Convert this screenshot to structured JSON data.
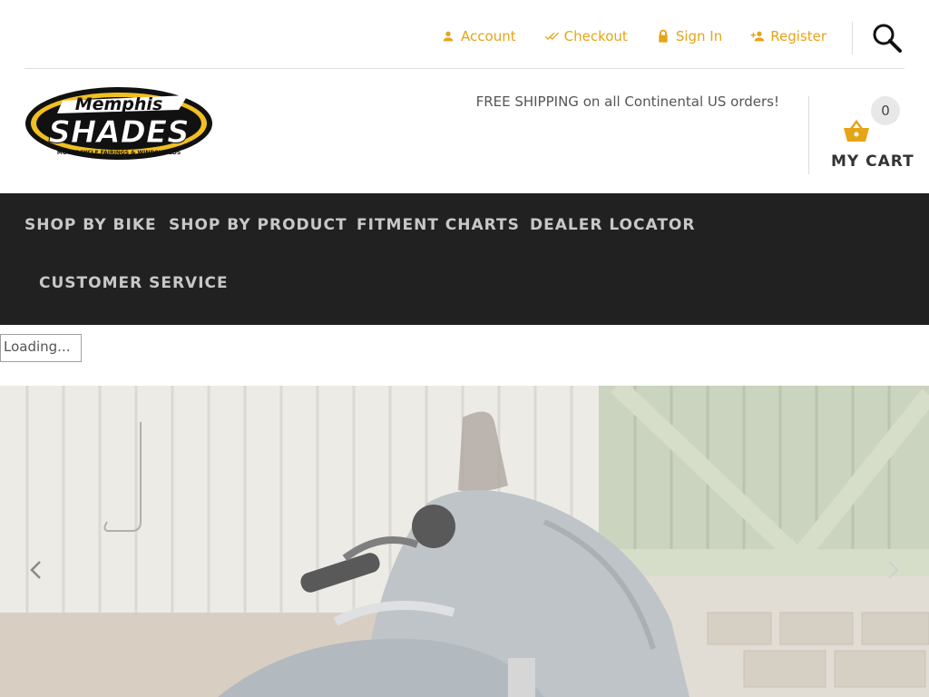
{
  "topbar": {
    "links": [
      {
        "label": "Account",
        "icon": "person-icon"
      },
      {
        "label": "Checkout",
        "icon": "double-check-icon"
      },
      {
        "label": "Sign In",
        "icon": "lock-icon"
      },
      {
        "label": "Register",
        "icon": "person-add-icon"
      }
    ],
    "search_icon": "search-icon"
  },
  "header": {
    "logo": {
      "top_text": "Memphis",
      "main_text": "SHADES",
      "tagline": "MOTORCYCLE FAIRINGS & WINDSHIELDS"
    },
    "shipping_text": "FREE SHIPPING on all Continental US orders!",
    "cart": {
      "count": "0",
      "label": "MY CART",
      "icon": "basket-icon"
    }
  },
  "nav": {
    "items": [
      {
        "label": "SHOP BY BIKE"
      },
      {
        "label": "SHOP BY PRODUCT"
      },
      {
        "label": "FITMENT CHARTS"
      },
      {
        "label": "DEALER LOCATOR"
      },
      {
        "label": "CUSTOMER SERVICE"
      }
    ]
  },
  "loading_text": "Loading...",
  "hero": {
    "prev_icon": "chevron-left-icon",
    "next_icon": "chevron-right-icon"
  },
  "colors": {
    "accent": "#e6a417",
    "nav_bg": "#212121",
    "nav_text": "#c8c8c8"
  }
}
